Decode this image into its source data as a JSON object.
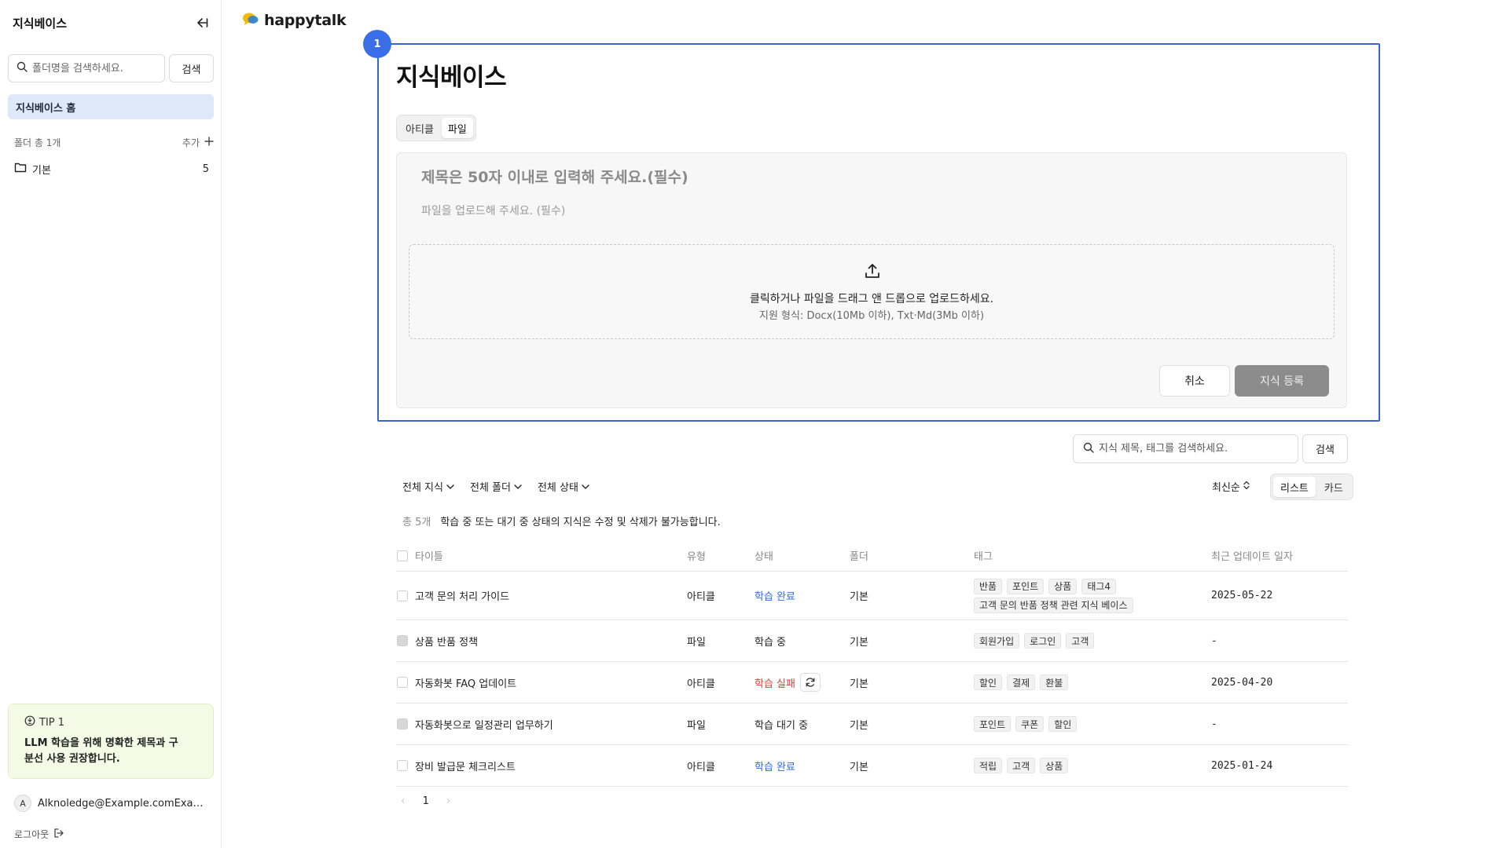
{
  "sidebar": {
    "title": "지식베이스",
    "search_placeholder": "폴더명을 검색하세요.",
    "search_button": "검색",
    "home_label": "지식베이스 홈",
    "folder_count": "폴더 총 1개",
    "add_label": "추가",
    "folders": [
      {
        "name": "기본",
        "count": "5"
      }
    ],
    "tip": {
      "label": "TIP 1",
      "text": "LLM 학습을 위해 명확한 제목과 구분선 사용 권장합니다."
    },
    "user": {
      "avatar_initial": "A",
      "email": "Alknoledge@Example.comExample.com"
    },
    "logout_label": "로그아웃"
  },
  "logo": {
    "text": "happytalk"
  },
  "badge": "1",
  "main": {
    "page_title": "지식베이스",
    "tabs": [
      {
        "label": "아티클",
        "active": false
      },
      {
        "label": "파일",
        "active": true
      }
    ],
    "form": {
      "title_placeholder": "제목은 50자 이내로 입력해 주세요.(필수)",
      "file_hint": "파일을 업로드해 주세요. (필수)",
      "dropzone_main": "클릭하거나 파일을 드래그 앤 드롭으로 업로드하세요.",
      "dropzone_sub": "지원 형식: Docx(10Mb 이하), Txt·Md(3Mb 이하)",
      "cancel_label": "취소",
      "submit_label": "지식 등록"
    },
    "list": {
      "search_placeholder": "지식 제목, 태그를 검색하세요.",
      "search_button": "검색",
      "filters": [
        "전체 지식",
        "전체 폴더",
        "전체 상태"
      ],
      "sort_label": "최신순",
      "views": [
        {
          "label": "리스트",
          "active": true
        },
        {
          "label": "카드",
          "active": false
        }
      ],
      "total": "총 5개",
      "notice": "학습 중 또는 대기 중 상태의 지식은 수정 및 삭제가 불가능합니다.",
      "columns": {
        "title": "타이틀",
        "type": "유형",
        "status": "상태",
        "folder": "폴더",
        "tags": "태그",
        "updated": "최근 업데이트 일자"
      },
      "rows": [
        {
          "title": "고객 문의 처리 가이드",
          "type": "아티클",
          "status": "학습 완료",
          "status_kind": "done",
          "folder": "기본",
          "tags": [
            "반품",
            "포인트",
            "상품",
            "태그4",
            "고객 문의 반품 정책 관련 지식 베이스"
          ],
          "updated": "2025-05-22",
          "disabled": false
        },
        {
          "title": "상품 반품 정책",
          "type": "파일",
          "status": "학습 중",
          "status_kind": "progress",
          "folder": "기본",
          "tags": [
            "회원가입",
            "로그인",
            "고객"
          ],
          "updated": "-",
          "disabled": true
        },
        {
          "title": "자동화봇 FAQ 업데이트",
          "type": "아티클",
          "status": "학습 실패",
          "status_kind": "fail",
          "folder": "기본",
          "tags": [
            "할인",
            "결제",
            "환불"
          ],
          "updated": "2025-04-20",
          "disabled": false
        },
        {
          "title": "자동화봇으로 일정관리 업무하기",
          "type": "파일",
          "status": "학습 대기 중",
          "status_kind": "waiting",
          "folder": "기본",
          "tags": [
            "포인트",
            "쿠폰",
            "할인"
          ],
          "updated": "-",
          "disabled": true
        },
        {
          "title": "장비 발급문 체크리스트",
          "type": "아티클",
          "status": "학습 완료",
          "status_kind": "done",
          "folder": "기본",
          "tags": [
            "적립",
            "고객",
            "상품"
          ],
          "updated": "2025-01-24",
          "disabled": false
        }
      ],
      "page": "1"
    }
  },
  "colors": {
    "accent": "#3a6ee8",
    "highlight_border": "#3a64d0",
    "status_done": "#2f6ad8",
    "status_fail": "#e0413a",
    "tip_bg": "#f5fae6",
    "home_bg": "#dde9f8"
  },
  "icons": {
    "collapse": "collapse-sidebar-icon",
    "search": "search-icon",
    "plus": "plus-icon",
    "folder": "folder-icon",
    "tip": "lightbulb-icon",
    "logout": "logout-icon",
    "upload": "upload-icon",
    "chevron": "chevron-down-icon",
    "sort": "sort-icon",
    "retry": "refresh-icon"
  }
}
